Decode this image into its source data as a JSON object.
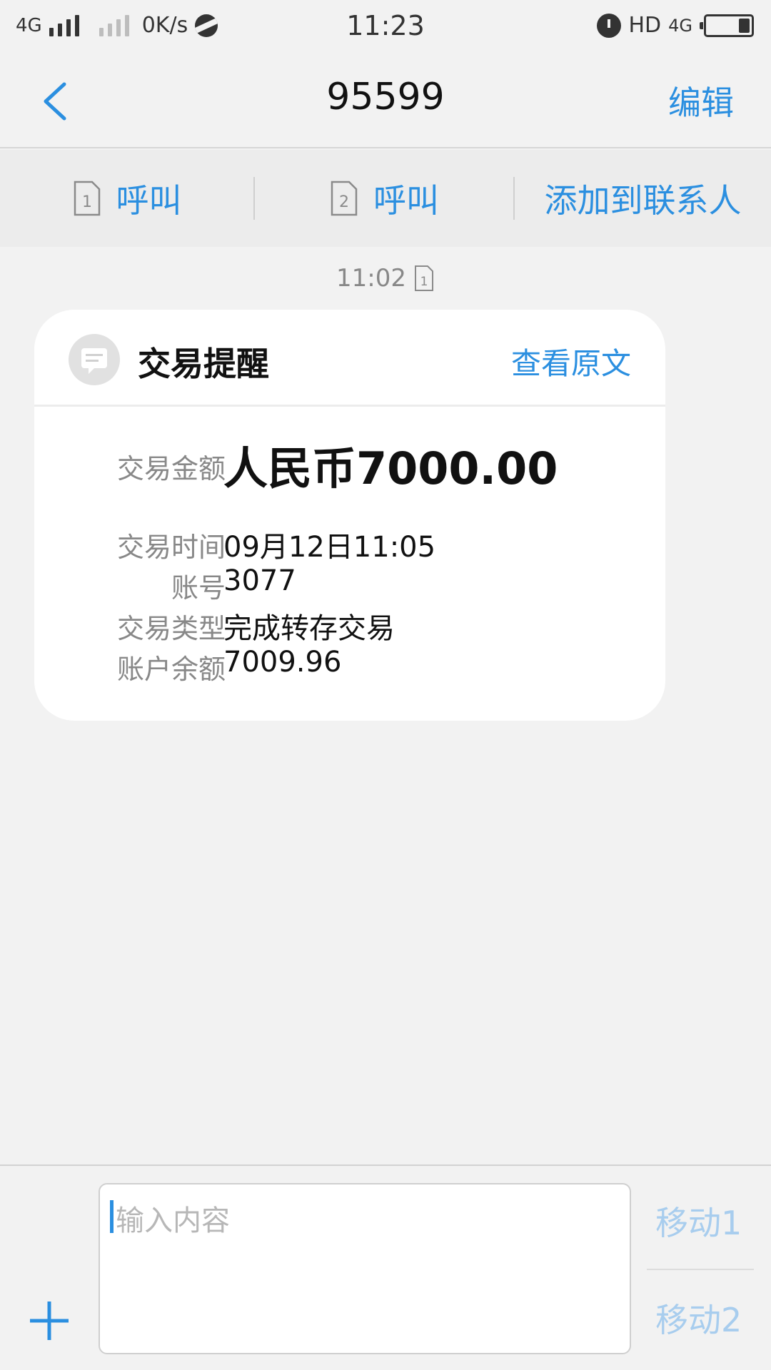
{
  "status_bar": {
    "network_type": "4G",
    "speed": "0K/s",
    "time": "11:23",
    "hd": "HD",
    "network_type_2": "4G",
    "battery_level": 0.25
  },
  "header": {
    "title": "95599",
    "edit_label": "编辑"
  },
  "actions": {
    "call1_label": "呼叫",
    "call2_label": "呼叫",
    "add_contact_label": "添加到联系人",
    "sim1": "1",
    "sim2": "2"
  },
  "message": {
    "time": "11:02",
    "sim": "1",
    "card": {
      "title": "交易提醒",
      "view_original_label": "查看原文",
      "amount_label": "交易金额",
      "amount_value": "人民币7000.00",
      "rows": [
        {
          "label": "交易时间",
          "value": "09月12日11:05"
        },
        {
          "label": "账号",
          "value": "3077"
        },
        {
          "label": "交易类型",
          "value": "完成转存交易"
        },
        {
          "label": "账户余额",
          "value": "7009.96"
        }
      ]
    }
  },
  "composer": {
    "placeholder": "输入内容",
    "send1_label": "移动1",
    "send2_label": "移动2"
  },
  "colors": {
    "accent": "#2b8fe0",
    "accent_disabled": "#a8cdee",
    "background": "#f2f2f2"
  }
}
